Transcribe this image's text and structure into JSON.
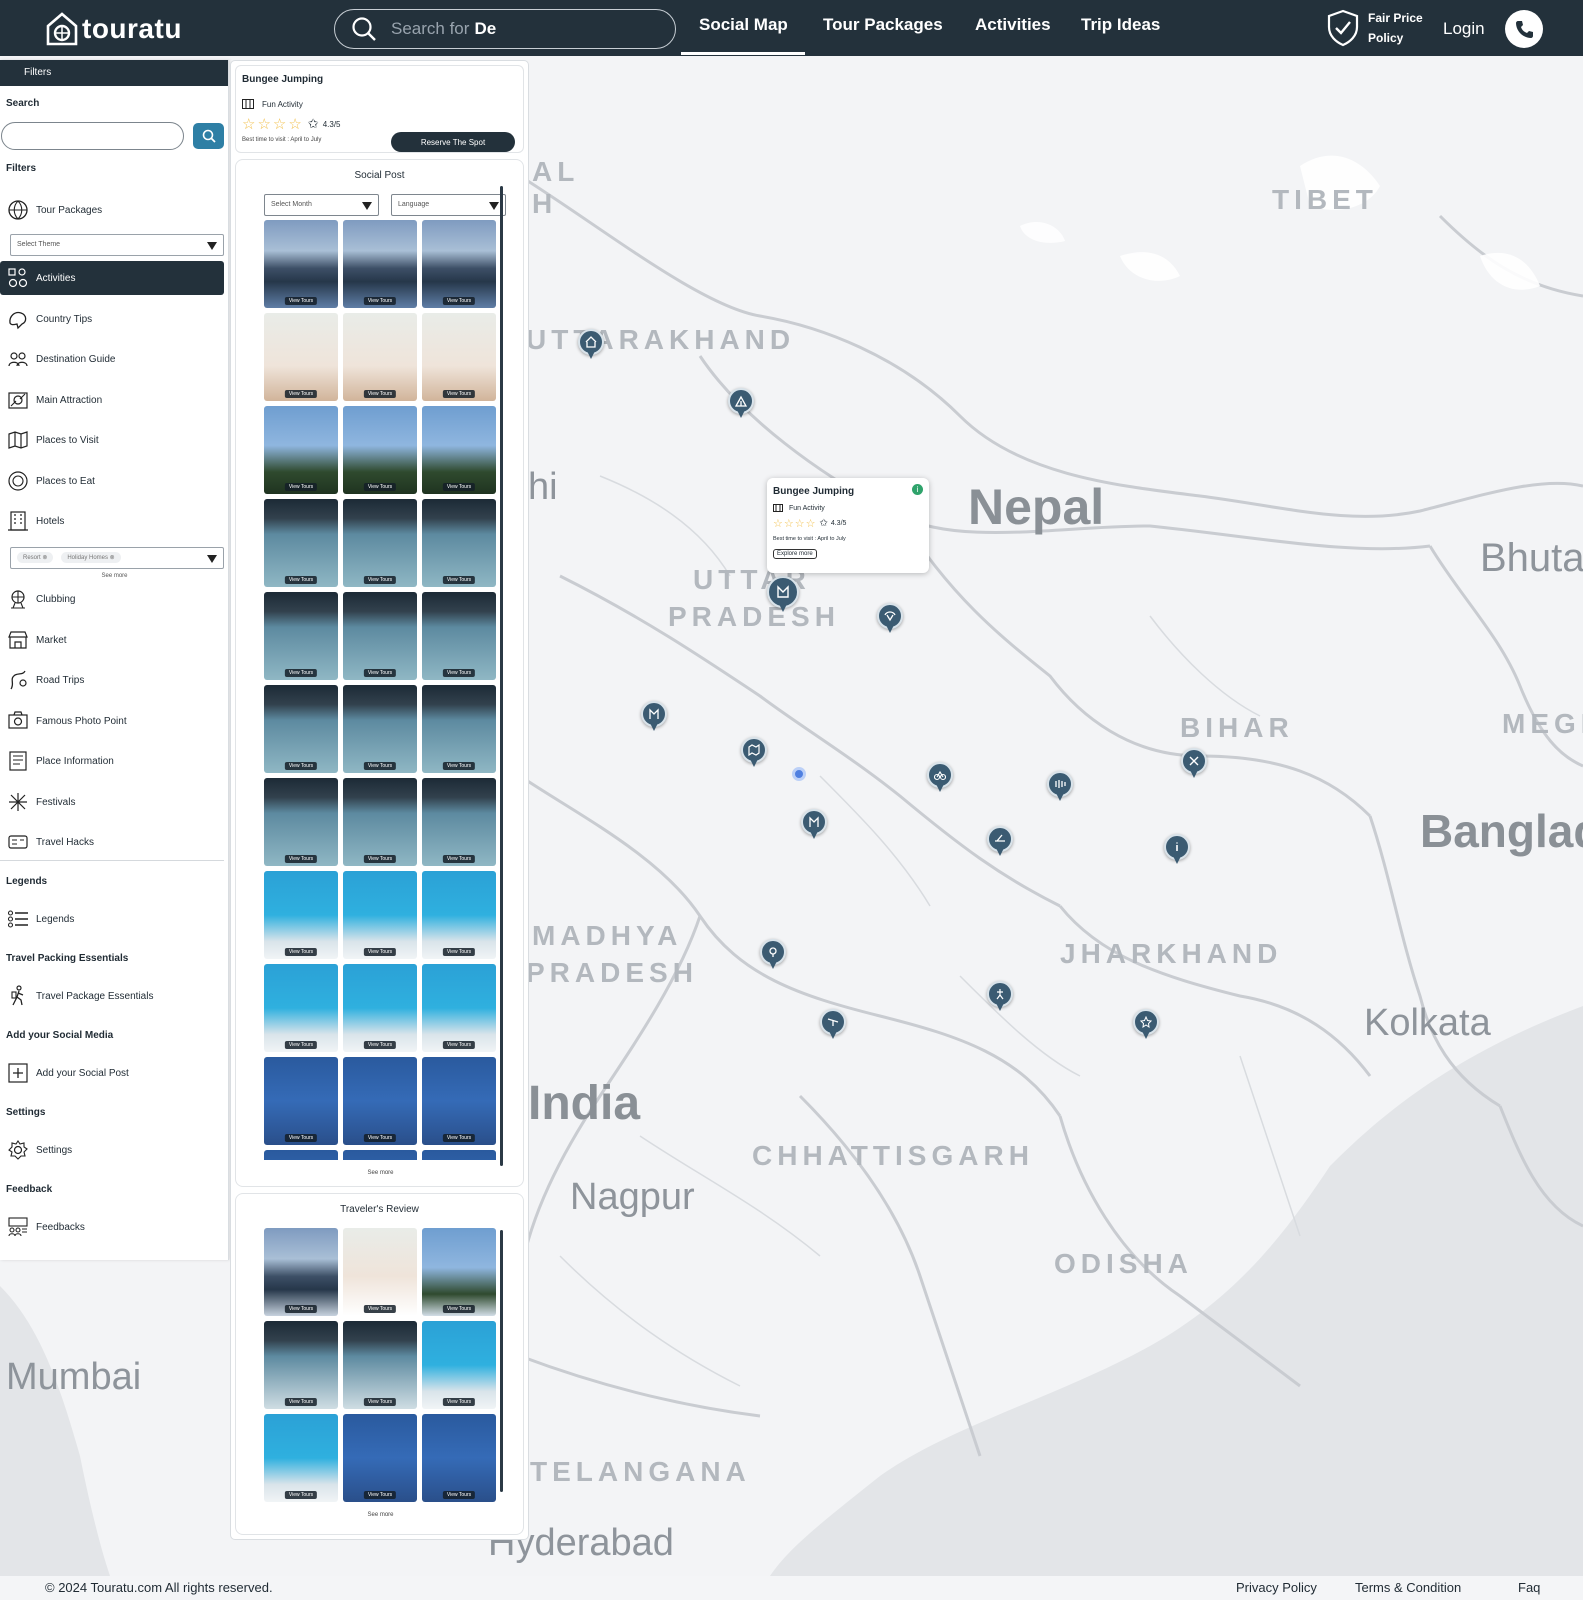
{
  "brand": {
    "name": "touratu"
  },
  "search": {
    "placeholder": "Search for",
    "value": "De"
  },
  "nav": {
    "links": [
      "Social Map",
      "Tour Packages",
      "Activities",
      "Trip Ideas"
    ],
    "active": "Social Map",
    "fair_price": [
      "Fair Price",
      "Policy"
    ],
    "login": "Login"
  },
  "sidebar": {
    "tab": "Filters",
    "search_title": "Search",
    "filters_title": "Filters",
    "tour_packages": "Tour Packages",
    "theme_select": "Select Theme",
    "items": [
      {
        "label": "Activities",
        "icon": "activities-icon",
        "active": true
      },
      {
        "label": "Country Tips",
        "icon": "country-tips-icon"
      },
      {
        "label": "Destination Guide",
        "icon": "destination-guide-icon"
      },
      {
        "label": "Main Attraction",
        "icon": "main-attraction-icon"
      },
      {
        "label": "Places to Visit",
        "icon": "places-to-visit-icon"
      },
      {
        "label": "Places to Eat",
        "icon": "places-to-eat-icon"
      },
      {
        "label": "Hotels",
        "icon": "hotels-icon"
      }
    ],
    "hotel_chips": [
      "Resort",
      "Holiday Homes"
    ],
    "see_more": "See more",
    "items2": [
      {
        "label": "Clubbing",
        "icon": "clubbing-icon"
      },
      {
        "label": "Market",
        "icon": "market-icon"
      },
      {
        "label": "Road Trips",
        "icon": "road-trips-icon"
      },
      {
        "label": "Famous Photo Point",
        "icon": "photo-point-icon"
      },
      {
        "label": "Place Information",
        "icon": "place-information-icon"
      },
      {
        "label": "Festivals",
        "icon": "festivals-icon"
      },
      {
        "label": "Travel Hacks",
        "icon": "travel-hacks-icon"
      }
    ],
    "legends_title": "Legends",
    "legends_item": "Legends",
    "packing_title": "Travel Packing Essentials",
    "packing_item": "Travel Package Essentials",
    "social_title": "Add your Social Media",
    "social_item": "Add your Social Post",
    "settings_title": "Settings",
    "settings_item": "Settings",
    "feedback_title": "Feedback",
    "feedback_item": "Feedbacks"
  },
  "activity_card": {
    "title": "Bungee Jumping",
    "category": "Fun Activity",
    "rating": "4.3/5",
    "best_time": "Best time to visit : April to July",
    "reserve": "Reserve The Spot"
  },
  "social_post": {
    "title": "Social Post",
    "month_select": "Select Month",
    "language_select": "Language",
    "tile_button": "View Tours",
    "rows": [
      "lake",
      "rope",
      "tower",
      "bridge",
      "bridge",
      "bridge",
      "bridge",
      "sea",
      "sea",
      "zip"
    ],
    "see_more": "See more"
  },
  "reviews": {
    "title": "Traveler's Review",
    "tiles": [
      "reflake",
      "refrope",
      "reftower",
      "refbridge",
      "refbridge",
      "sea",
      "sea",
      "zip",
      "zip"
    ],
    "tile_button": "View Tours",
    "see_more": "See more"
  },
  "map": {
    "popup": {
      "title": "Bungee Jumping",
      "category": "Fun Activity",
      "rating": "4.3/5",
      "best_time": "Best time to visit : April to July",
      "button": "Explore more"
    },
    "labels": [
      "TIBET",
      "UTTARAKHAND",
      "hi",
      "Nepal",
      "Bhuta",
      "UTTAR",
      "PRADESH",
      "BIHAR",
      "MEGH",
      "Banglad",
      "MADHYA",
      "PRADESH",
      "JHARKHAND",
      "Kolkata",
      "India",
      "CHHATTISGARH",
      "Nagpur",
      "ODISHA",
      "Mumbai",
      "TELANGANA",
      "Hyderabad",
      "AL",
      "H"
    ]
  },
  "footer": {
    "copyright": "© 2024 Touratu.com All rights reserved.",
    "links": [
      "Privacy Policy",
      "Terms & Condition",
      "Faq"
    ]
  },
  "colors": {
    "nav_bg": "#23313b",
    "pin": "#3b5b72",
    "accent": "#2e7fa5",
    "star": "#f2c14e",
    "status_green": "#2fa36b"
  }
}
